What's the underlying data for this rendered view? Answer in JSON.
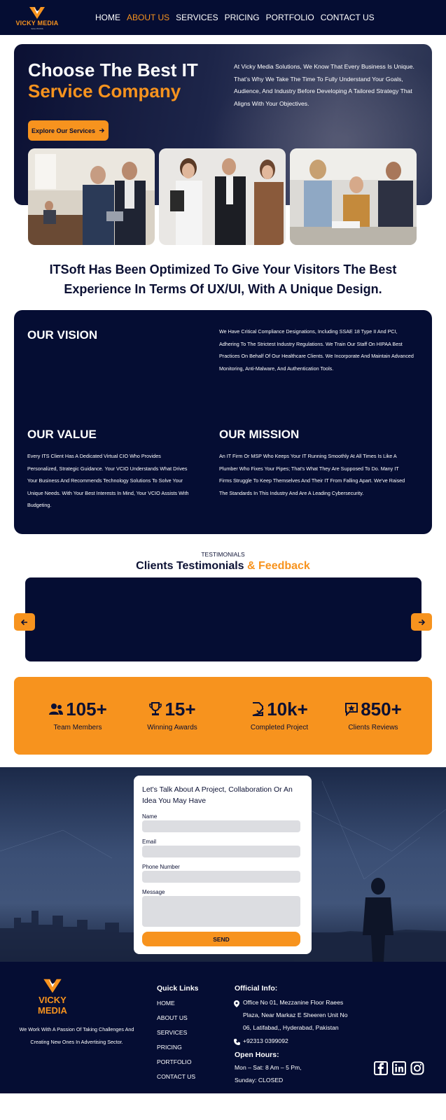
{
  "nav": {
    "logo_text": "VICKY MEDIA",
    "logo_sub": "SOLUTIONS",
    "links": [
      "HOME",
      "ABOUT US",
      "SERVICES",
      "PRICING",
      "PORTFOLIO",
      "CONTACT US"
    ],
    "active": "ABOUT US"
  },
  "hero": {
    "title_line1": "Choose The Best IT",
    "title_line2": "Service Company",
    "description": "At Vicky Media Solutions, We Know That Every Business Is Unique. That's Why We Take The Time To Fully Understand Your Goals, Audience, And Industry Before Developing A Tailored Strategy That Aligns With Your Objectives.",
    "button_label": "Explore Our Services"
  },
  "headline": {
    "line1": "ITSoft Has Been Optimized To Give Your Visitors The Best",
    "line2": "Experience In Terms Of UX/UI, With A Unique Design."
  },
  "vision": {
    "vision_title": "OUR VISION",
    "vision_text": "We Have Critical Compliance Designations, Including SSAE 18 Type II And PCI, Adhering To The Strictest Industry Regulations. We Train Our Staff On HIPAA Best Practices On Behalf Of Our Healthcare Clients. We Incorporate And Maintain Advanced Monitoring, Anti-Malware, And Authentication Tools.",
    "value_title": "OUR VALUE",
    "value_text": "Every ITS Client Has A Dedicated Virtual CIO Who Provides Personalized, Strategic Guidance. Your VCIO Understands What Drives Your Business And Recommends Technology Solutions To Solve Your Unique Needs. With Your Best Interests In Mind, Your VCIO Assists With Budgeting.",
    "mission_title": "OUR MISSION",
    "mission_text": "An IT Firm Or MSP Who Keeps Your IT Running Smoothly At All Times Is Like A Plumber Who Fixes Your Pipes; That's What They Are Supposed To Do. Many IT Firms Struggle To Keep Themselves And Their IT From Falling Apart. We've Raised The Standards In This Industry And Are A Leading Cybersecurity."
  },
  "testimonials": {
    "kicker": "TESTIMONIALS",
    "title_main": "Clients Testimonials",
    "title_accent": "& Feedback"
  },
  "stats": [
    {
      "icon": "team-icon",
      "value": "105+",
      "label": "Team Members"
    },
    {
      "icon": "trophy-icon",
      "value": "15+",
      "label": "Winning Awards"
    },
    {
      "icon": "project-icon",
      "value": "10k+",
      "label": "Completed Project"
    },
    {
      "icon": "review-icon",
      "value": "850+",
      "label": "Clients Reviews"
    }
  ],
  "contact_form": {
    "title": "Let's Talk About A Project, Collaboration Or An Idea You May Have",
    "name_label": "Name",
    "email_label": "Email",
    "phone_label": "Phone Number",
    "message_label": "Message",
    "send_label": "SEND"
  },
  "footer": {
    "logo_text": "VICKY MEDIA",
    "about": "We Work With A Passion Of Taking Challenges And Creating New Ones In Advertising Sector.",
    "quick_links_title": "Quick Links",
    "quick_links": [
      "HOME",
      "ABOUT US",
      "SERVICES",
      "PRICING",
      "PORTFOLIO",
      "CONTACT US"
    ],
    "official_info_title": "Official Info:",
    "address_line1": "Office No 01, Mezzanine Floor Raees",
    "address_line2": "Plaza, Near Markaz E Sheeren Unit No",
    "address_line3": "06, Latifabad,, Hyderabad, Pakistan",
    "phone": "+92313 0399092",
    "open_hours_title": "Open Hours:",
    "hours_line1": "Mon – Sat: 8 Am – 5 Pm,",
    "hours_line2": "Sunday: CLOSED",
    "social": [
      "facebook-icon",
      "linkedin-icon",
      "instagram-icon"
    ]
  },
  "colors": {
    "navy": "#050d33",
    "orange": "#f7931e",
    "input_gray": "#dcdde1"
  }
}
